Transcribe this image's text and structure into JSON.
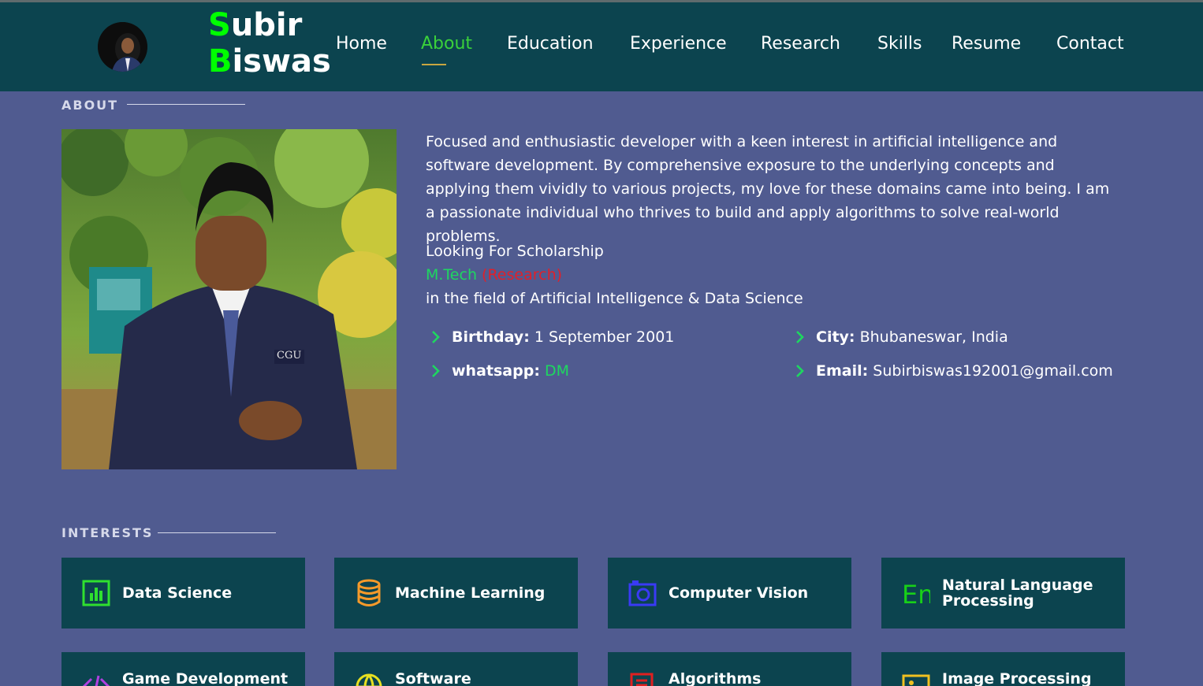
{
  "header": {
    "logo_first_letter": "S",
    "logo_first_rest": "ubir",
    "logo_second_letter": "B",
    "logo_second_rest": "iswas",
    "nav": [
      {
        "label": "Home",
        "active": false
      },
      {
        "label": "About",
        "active": true
      },
      {
        "label": "Education",
        "active": false
      },
      {
        "label": "Experience",
        "active": false
      },
      {
        "label": "Research",
        "active": false
      },
      {
        "label": "Skills",
        "active": false
      },
      {
        "label": "Resume",
        "active": false
      },
      {
        "label": "Contact",
        "active": false
      }
    ]
  },
  "about": {
    "section_title": "ABOUT",
    "bio": "Focused and enthusiastic developer with a keen interest in artificial intelligence and software development. By comprehensive exposure to the underlying concepts and applying them vividly to various projects, my love for these domains came into being. I am a passionate individual who thrives to build and apply algorithms to solve real-world problems.",
    "scholarship_line": "Looking For Scholarship",
    "degree": "M.Tech",
    "degree_type": "(Research)",
    "field_line": "in the field of Artificial Intelligence & Data Science",
    "info": {
      "birthday_label": "Birthday:",
      "birthday_value": "1 September 2001",
      "city_label": "City:",
      "city_value": "Bhubaneswar, India",
      "whatsapp_label": "whatsapp:",
      "whatsapp_value": "DM",
      "email_label": "Email:",
      "email_value": "Subirbiswas192001@gmail.com"
    },
    "photo_badge": "CGU"
  },
  "interests": {
    "section_title": "INTERESTS",
    "items": [
      {
        "label": "Data Science",
        "icon": "bar-chart-icon",
        "color": "#2fe02f"
      },
      {
        "label": "Machine Learning",
        "icon": "database-icon",
        "color": "#f59a2a"
      },
      {
        "label": "Computer Vision",
        "icon": "camera-icon",
        "color": "#3a3af5"
      },
      {
        "label": "Natural Language Processing",
        "icon": "language-en-icon",
        "color": "#18d018"
      },
      {
        "label": "Game Development",
        "icon": "code-icon",
        "color": "#b040e0"
      },
      {
        "label": "Software",
        "icon": "globe-icon",
        "color": "#e8e020"
      },
      {
        "label": "Algorithms",
        "icon": "document-icon",
        "color": "#e02020"
      },
      {
        "label": "Image Processing",
        "icon": "image-icon",
        "color": "#f0c020"
      }
    ]
  },
  "colors": {
    "page_bg": "#505b90",
    "header_bg": "#0c444f",
    "accent_green": "#00ff00",
    "link_green": "#1ed760",
    "highlight_red": "#e0202a",
    "nav_underline": "#c9a640"
  }
}
